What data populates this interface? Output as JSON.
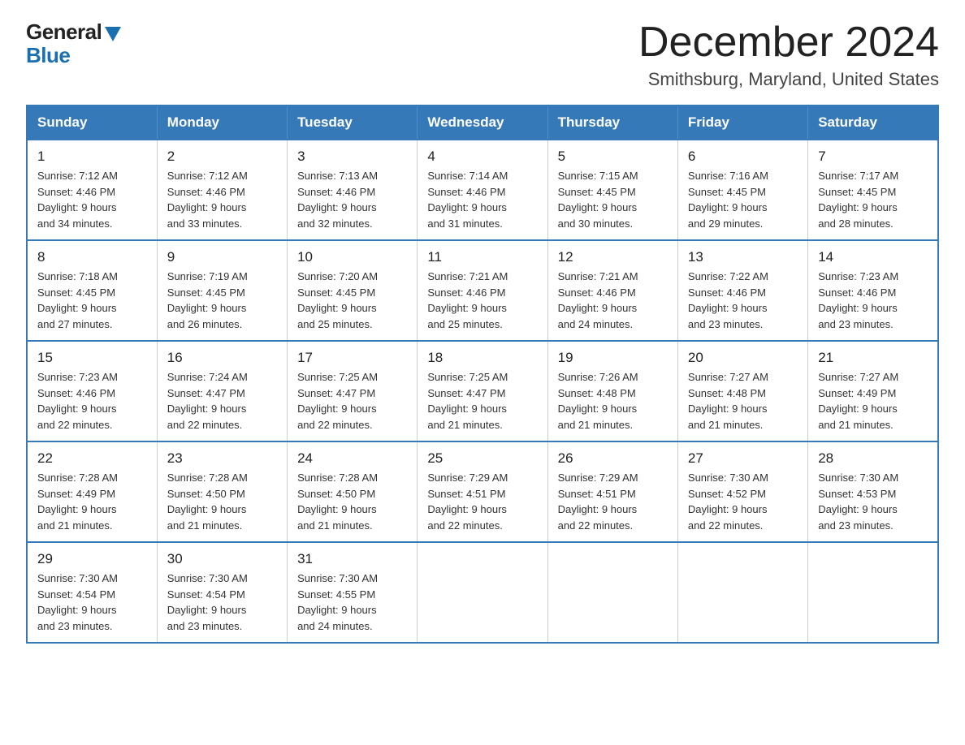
{
  "logo": {
    "general": "General",
    "blue": "Blue"
  },
  "header": {
    "month": "December 2024",
    "location": "Smithsburg, Maryland, United States"
  },
  "days_of_week": [
    "Sunday",
    "Monday",
    "Tuesday",
    "Wednesday",
    "Thursday",
    "Friday",
    "Saturday"
  ],
  "weeks": [
    [
      {
        "day": "1",
        "sunrise": "7:12 AM",
        "sunset": "4:46 PM",
        "daylight": "9 hours and 34 minutes."
      },
      {
        "day": "2",
        "sunrise": "7:12 AM",
        "sunset": "4:46 PM",
        "daylight": "9 hours and 33 minutes."
      },
      {
        "day": "3",
        "sunrise": "7:13 AM",
        "sunset": "4:46 PM",
        "daylight": "9 hours and 32 minutes."
      },
      {
        "day": "4",
        "sunrise": "7:14 AM",
        "sunset": "4:46 PM",
        "daylight": "9 hours and 31 minutes."
      },
      {
        "day": "5",
        "sunrise": "7:15 AM",
        "sunset": "4:45 PM",
        "daylight": "9 hours and 30 minutes."
      },
      {
        "day": "6",
        "sunrise": "7:16 AM",
        "sunset": "4:45 PM",
        "daylight": "9 hours and 29 minutes."
      },
      {
        "day": "7",
        "sunrise": "7:17 AM",
        "sunset": "4:45 PM",
        "daylight": "9 hours and 28 minutes."
      }
    ],
    [
      {
        "day": "8",
        "sunrise": "7:18 AM",
        "sunset": "4:45 PM",
        "daylight": "9 hours and 27 minutes."
      },
      {
        "day": "9",
        "sunrise": "7:19 AM",
        "sunset": "4:45 PM",
        "daylight": "9 hours and 26 minutes."
      },
      {
        "day": "10",
        "sunrise": "7:20 AM",
        "sunset": "4:45 PM",
        "daylight": "9 hours and 25 minutes."
      },
      {
        "day": "11",
        "sunrise": "7:21 AM",
        "sunset": "4:46 PM",
        "daylight": "9 hours and 25 minutes."
      },
      {
        "day": "12",
        "sunrise": "7:21 AM",
        "sunset": "4:46 PM",
        "daylight": "9 hours and 24 minutes."
      },
      {
        "day": "13",
        "sunrise": "7:22 AM",
        "sunset": "4:46 PM",
        "daylight": "9 hours and 23 minutes."
      },
      {
        "day": "14",
        "sunrise": "7:23 AM",
        "sunset": "4:46 PM",
        "daylight": "9 hours and 23 minutes."
      }
    ],
    [
      {
        "day": "15",
        "sunrise": "7:23 AM",
        "sunset": "4:46 PM",
        "daylight": "9 hours and 22 minutes."
      },
      {
        "day": "16",
        "sunrise": "7:24 AM",
        "sunset": "4:47 PM",
        "daylight": "9 hours and 22 minutes."
      },
      {
        "day": "17",
        "sunrise": "7:25 AM",
        "sunset": "4:47 PM",
        "daylight": "9 hours and 22 minutes."
      },
      {
        "day": "18",
        "sunrise": "7:25 AM",
        "sunset": "4:47 PM",
        "daylight": "9 hours and 21 minutes."
      },
      {
        "day": "19",
        "sunrise": "7:26 AM",
        "sunset": "4:48 PM",
        "daylight": "9 hours and 21 minutes."
      },
      {
        "day": "20",
        "sunrise": "7:27 AM",
        "sunset": "4:48 PM",
        "daylight": "9 hours and 21 minutes."
      },
      {
        "day": "21",
        "sunrise": "7:27 AM",
        "sunset": "4:49 PM",
        "daylight": "9 hours and 21 minutes."
      }
    ],
    [
      {
        "day": "22",
        "sunrise": "7:28 AM",
        "sunset": "4:49 PM",
        "daylight": "9 hours and 21 minutes."
      },
      {
        "day": "23",
        "sunrise": "7:28 AM",
        "sunset": "4:50 PM",
        "daylight": "9 hours and 21 minutes."
      },
      {
        "day": "24",
        "sunrise": "7:28 AM",
        "sunset": "4:50 PM",
        "daylight": "9 hours and 21 minutes."
      },
      {
        "day": "25",
        "sunrise": "7:29 AM",
        "sunset": "4:51 PM",
        "daylight": "9 hours and 22 minutes."
      },
      {
        "day": "26",
        "sunrise": "7:29 AM",
        "sunset": "4:51 PM",
        "daylight": "9 hours and 22 minutes."
      },
      {
        "day": "27",
        "sunrise": "7:30 AM",
        "sunset": "4:52 PM",
        "daylight": "9 hours and 22 minutes."
      },
      {
        "day": "28",
        "sunrise": "7:30 AM",
        "sunset": "4:53 PM",
        "daylight": "9 hours and 23 minutes."
      }
    ],
    [
      {
        "day": "29",
        "sunrise": "7:30 AM",
        "sunset": "4:54 PM",
        "daylight": "9 hours and 23 minutes."
      },
      {
        "day": "30",
        "sunrise": "7:30 AM",
        "sunset": "4:54 PM",
        "daylight": "9 hours and 23 minutes."
      },
      {
        "day": "31",
        "sunrise": "7:30 AM",
        "sunset": "4:55 PM",
        "daylight": "9 hours and 24 minutes."
      },
      null,
      null,
      null,
      null
    ]
  ],
  "labels": {
    "sunrise": "Sunrise:",
    "sunset": "Sunset:",
    "daylight": "Daylight:"
  }
}
